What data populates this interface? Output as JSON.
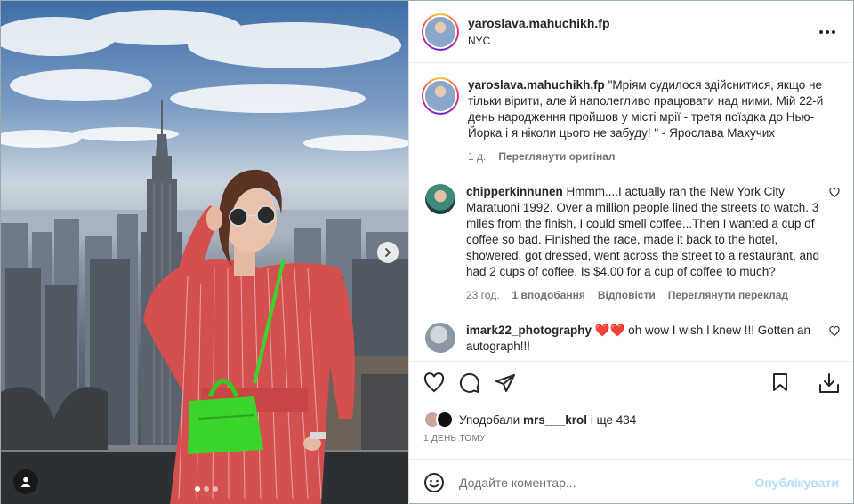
{
  "post": {
    "username": "yaroslava.mahuchikh.fp",
    "location": "NYC"
  },
  "caption": {
    "username": "yaroslava.mahuchikh.fp",
    "text": "\"Мріям судилося здійснитися, якщо не тільки вірити, але й наполегливо працювати над ними. Мій 22-й день народження пройшов у місті мрії - третя поїздка до Нью-Йорка і я ніколи цього не забуду! \" - Ярослава Махучих",
    "age": "1 д.",
    "see_original": "Переглянути оригінал"
  },
  "comments": [
    {
      "username": "chipperkinnunen",
      "text": "Hmmm....I actually ran the New York City Maratuoni 1992. Over a million people lined the streets to watch. 3 miles from the finish, I could smell coffee...Then I wanted a cup of coffee so bad. Finished the race, made it back to the hotel, showered, got dressed, went across the street to a restaurant, and had 2 cups of coffee. Is $4.00 for a cup of coffee to much?",
      "age": "23 год.",
      "likes": "1 вподобання",
      "reply": "Відповісти",
      "translate": "Переглянути переклад"
    },
    {
      "username": "imark22_photography",
      "text": "❤️❤️ oh wow I wish I knew !!! Gotten an autograph!!!"
    }
  ],
  "likes": {
    "prefix": "Уподобали",
    "user": "mrs___krol",
    "suffix": "і ще 434"
  },
  "timestamp": "1 ДЕНЬ ТОМУ",
  "add_comment": {
    "placeholder": "Додайте коментар...",
    "post_label": "Опублікувати"
  },
  "carousel": {
    "current": 1,
    "total": 3
  },
  "colors": {
    "accent": "#0095f6",
    "post_disabled": "#b2dffc",
    "muted": "#737373"
  },
  "icons": [
    "chevron-right-icon",
    "user-tag-icon",
    "more-icon",
    "heart-icon",
    "comment-icon",
    "share-icon",
    "bookmark-icon",
    "download-icon",
    "emoji-icon"
  ]
}
